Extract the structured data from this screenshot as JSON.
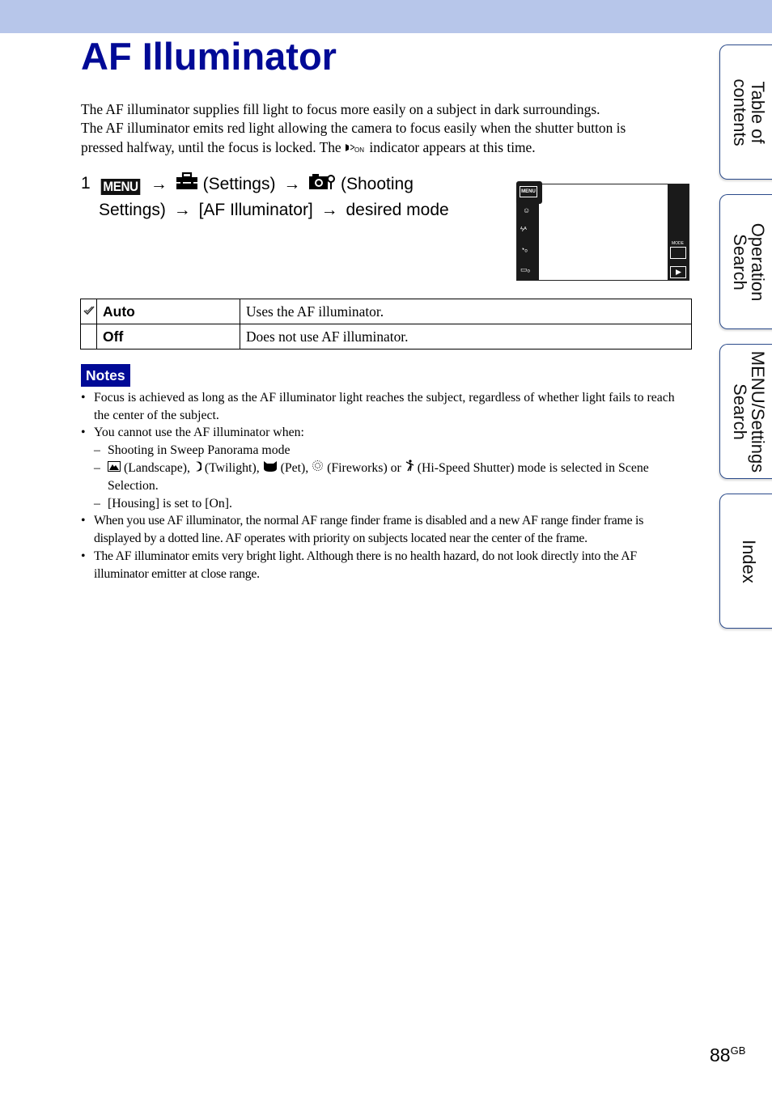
{
  "page": {
    "title": "AF Illuminator",
    "intro": {
      "line1": "The AF illuminator supplies fill light to focus more easily on a subject in dark surroundings.",
      "line2": "The AF illuminator emits red light allowing the camera to focus easily when the shutter button is",
      "line3_before": "pressed halfway, until the focus is locked. The",
      "line3_icon": "af-illuminator-on-icon",
      "line3_after": "indicator appears at this time."
    },
    "step": {
      "number": "1",
      "menu_label": "MENU",
      "arrow": "→",
      "settings_label": "(Settings)",
      "shooting_label": "(Shooting",
      "line2_a": "Settings)",
      "af_label": "[AF Illuminator]",
      "desired": "desired mode"
    },
    "screen": {
      "menu_btn": "MENU",
      "mode_label": "MODE",
      "icons": [
        "smile-shutter-icon",
        "flash-auto-icon",
        "self-timer-off-icon",
        "burst-off-icon"
      ],
      "right_icons": [
        "intelligent-auto-icon",
        "playback-icon"
      ]
    },
    "options_table": [
      {
        "default": true,
        "name": "Auto",
        "description": "Uses the AF illuminator."
      },
      {
        "default": false,
        "name": "Off",
        "description": "Does not use AF illuminator."
      }
    ],
    "notes": {
      "badge": "Notes",
      "bullet": "•",
      "dash": "–",
      "items": [
        "Focus is achieved as long as the AF illuminator light reaches the subject, regardless of whether light fails to reach the center of the subject.",
        "You cannot use the AF illuminator when:",
        "When you use AF illuminator, the normal AF range finder frame is disabled and a new AF range finder frame is displayed by a dotted line. AF operates with priority on subjects located near the center of the frame.",
        "The AF illuminator emits very bright light. Although there is no health hazard, do not look directly into the AF illuminator emitter at close range."
      ],
      "sub_items": {
        "sweep": "Shooting in Sweep Panorama mode",
        "scene_landscape": "(Landscape),",
        "scene_twilight": "(Twilight),",
        "scene_pet": "(Pet),",
        "scene_fireworks": "(Fireworks) or",
        "scene_hispeed": "(Hi-Speed Shutter) mode is selected in Scene Selection.",
        "housing": "[Housing] is set to [On]."
      }
    },
    "side_tabs": [
      {
        "line1": "Table of",
        "line2": "contents"
      },
      {
        "line1": "Operation",
        "line2": "Search"
      },
      {
        "line1": "MENU/Settings",
        "line2": "Search"
      },
      {
        "line1": "Index",
        "line2": ""
      }
    ],
    "page_number": "88",
    "page_suffix": "GB",
    "colors": {
      "title": "#000a96",
      "topbar": "#b7c6ea",
      "notes_badge": "#000a96"
    }
  }
}
